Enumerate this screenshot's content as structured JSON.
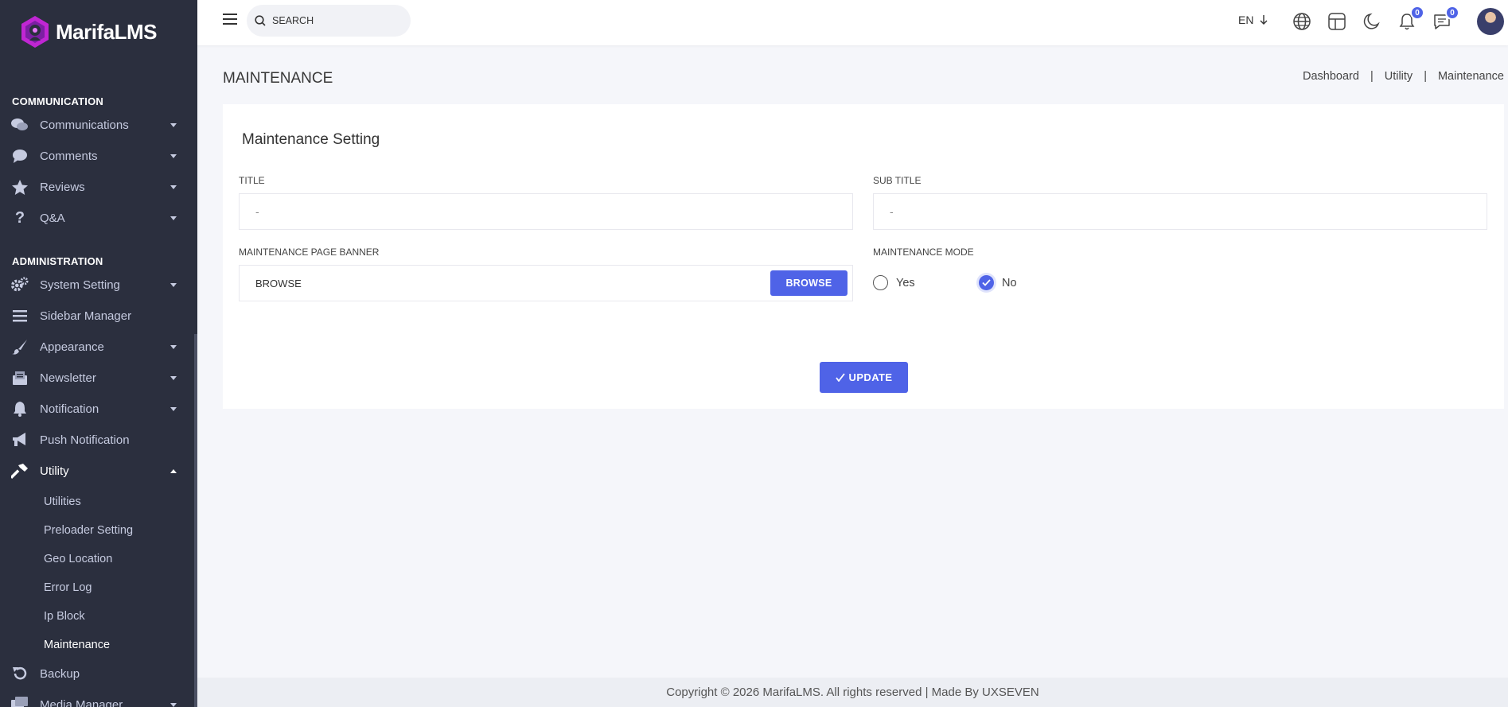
{
  "app": {
    "name": "MarifaLMS"
  },
  "sidebar": {
    "sections": {
      "communication": "COMMUNICATION",
      "administration": "ADMINISTRATION"
    },
    "items": {
      "communications": "Communications",
      "comments": "Comments",
      "reviews": "Reviews",
      "qa": "Q&A",
      "system_setting": "System Setting",
      "sidebar_manager": "Sidebar Manager",
      "appearance": "Appearance",
      "newsletter": "Newsletter",
      "notification": "Notification",
      "push_notification": "Push Notification",
      "utility": "Utility",
      "backup": "Backup",
      "media_manager": "Media Manager"
    },
    "utility_sub": {
      "utilities": "Utilities",
      "preloader": "Preloader Setting",
      "geo": "Geo Location",
      "error_log": "Error Log",
      "ip_block": "Ip Block",
      "maintenance": "Maintenance"
    },
    "icons": [
      "comments-icon",
      "comment-icon",
      "star-icon",
      "question-icon",
      "gears-icon",
      "bars-icon",
      "paint-brush-icon",
      "envelope-open-icon",
      "bell-icon",
      "bullhorn-icon",
      "hammer-icon",
      "undo-icon",
      "photo-video-icon"
    ]
  },
  "topbar": {
    "search_placeholder": "SEARCH",
    "language": "EN",
    "notification_count": "0",
    "message_count": "0"
  },
  "page": {
    "title": "MAINTENANCE",
    "breadcrumb": [
      "Dashboard",
      "Utility",
      "Maintenance"
    ]
  },
  "form": {
    "card_title": "Maintenance Setting",
    "title_label": "TITLE",
    "title_value": "-",
    "subtitle_label": "SUB TITLE",
    "subtitle_value": "-",
    "banner_label": "MAINTENANCE PAGE BANNER",
    "banner_text": "BROWSE",
    "banner_button": "BROWSE",
    "mode_label": "MAINTENANCE MODE",
    "mode_yes": "Yes",
    "mode_no": "No",
    "mode_selected": "No",
    "update_button": "UPDATE"
  },
  "footer": {
    "copyright": "Copyright © 2026 MarifaLMS. All rights reserved | Made By UXSEVEN"
  },
  "colors": {
    "accent": "#4f63e7",
    "sidebar_bg": "#2b2f3e"
  }
}
